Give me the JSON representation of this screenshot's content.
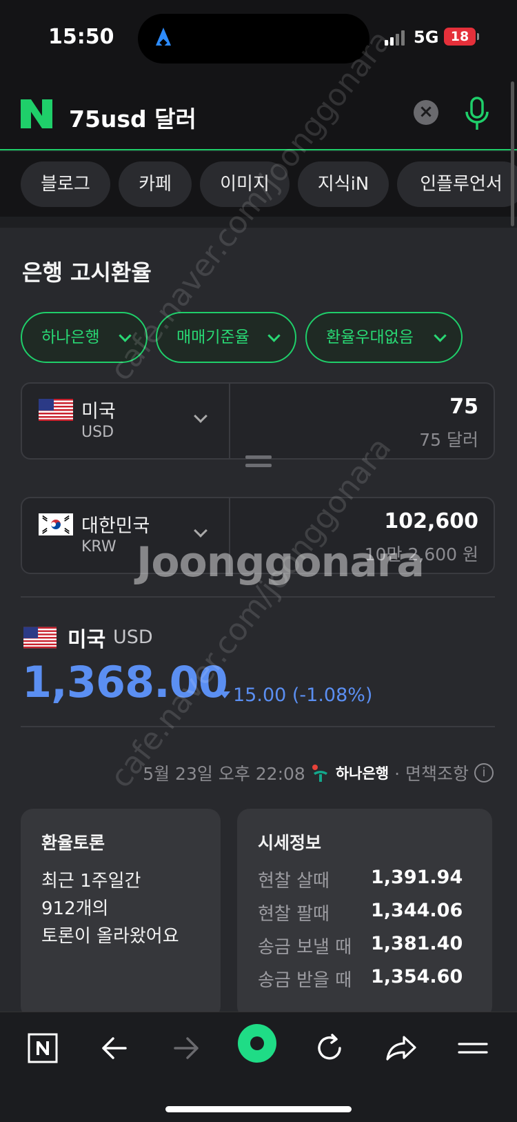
{
  "status_bar": {
    "time": "15:50",
    "network": "5G",
    "battery": "18"
  },
  "search": {
    "query": "75usd 달러",
    "logo": "N"
  },
  "tabs": [
    {
      "label": "블로그"
    },
    {
      "label": "카페"
    },
    {
      "label": "이미지"
    },
    {
      "label": "지식iN"
    },
    {
      "label": "인플루언서"
    }
  ],
  "exchange": {
    "title": "은행 고시환율",
    "filters": [
      {
        "label": "하나은행"
      },
      {
        "label": "매매기준율"
      },
      {
        "label": "환율우대없음"
      }
    ],
    "from": {
      "country": "미국",
      "code": "USD",
      "amount": "75",
      "amount_words": "75 달러"
    },
    "to": {
      "country": "대한민국",
      "code": "KRW",
      "amount": "102,600",
      "amount_words": "10만 2,600 원"
    },
    "rate": {
      "country": "미국",
      "code": "USD",
      "value": "1,368.00",
      "change": "15.00 (-1.08%)",
      "direction": "down"
    },
    "meta": {
      "timestamp": "5월 23일 오후 22:08",
      "bank": "하나은행",
      "disclaimer": "· 면책조항"
    }
  },
  "forum_card": {
    "title": "환율토론",
    "lines": [
      "최근 1주일간",
      "912개의",
      "토론이 올라왔어요"
    ]
  },
  "price_card": {
    "title": "시세정보",
    "rows": [
      {
        "label": "현찰 살때",
        "value": "1,391.94"
      },
      {
        "label": "현찰 팔때",
        "value": "1,344.06"
      },
      {
        "label": "송금 보낼 때",
        "value": "1,381.40"
      },
      {
        "label": "송금 받을 때",
        "value": "1,354.60"
      }
    ]
  },
  "watermark": {
    "brand": "Joonggonara",
    "url": "cafe.naver.com/joonggonara"
  },
  "colors": {
    "accent_green": "#1fcf6a",
    "rate_blue": "#5b8ff2",
    "background": "#28292d"
  }
}
